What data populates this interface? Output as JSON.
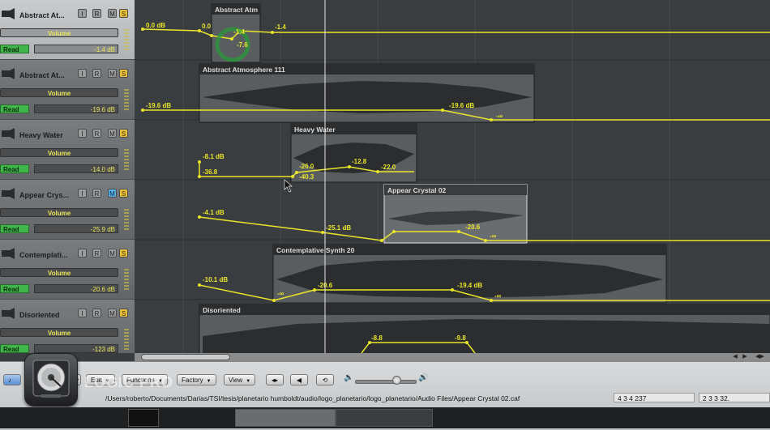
{
  "tracks": [
    {
      "name": "Abstract At...",
      "param": "Volume",
      "mode": "Read",
      "value": "-1.4 dB",
      "selected": true,
      "mute_on": false
    },
    {
      "name": "Abstract At...",
      "param": "Volume",
      "mode": "Read",
      "value": "-19.6 dB",
      "selected": false,
      "mute_on": false
    },
    {
      "name": "Heavy Water",
      "param": "Volume",
      "mode": "Read",
      "value": "-14.0 dB",
      "selected": false,
      "mute_on": false
    },
    {
      "name": "Appear Crys...",
      "param": "Volume",
      "mode": "Read",
      "value": "-25.9 dB",
      "selected": false,
      "mute_on": true
    },
    {
      "name": "Contemplati...",
      "param": "Volume",
      "mode": "Read",
      "value": "-20.6 dB",
      "selected": false,
      "mute_on": false
    },
    {
      "name": "Disoriented",
      "param": "Volume",
      "mode": "Read",
      "value": "-123 dB",
      "selected": false,
      "mute_on": false
    }
  ],
  "track_buttons": {
    "input": "I",
    "record": "R",
    "mute": "M",
    "solo": "S"
  },
  "regions": [
    {
      "name": "Abstract Atm"
    },
    {
      "name": "Abstract Atmosphere 111"
    },
    {
      "name": "Heavy Water"
    },
    {
      "name": "Appear Crystal 02"
    },
    {
      "name": "Contemplative Synth 20"
    },
    {
      "name": "Disoriented"
    }
  ],
  "automation_labels": [
    "0.0 dB",
    "0.0",
    "-1.4",
    "-7.6",
    "-1.4",
    "-19.6 dB",
    "-19.6 dB",
    "-∞",
    "-8.1 dB",
    "-36.8",
    "-26.0",
    "-40.3",
    "-12.8",
    "-22.0",
    "-4.1 dB",
    "-25.1 dB",
    "-20.6",
    "-∞",
    "-10.1 dB",
    "-∞",
    "-20.6",
    "-19.4 dB",
    "-∞",
    "-8.8",
    "-9.8"
  ],
  "toolbar": {
    "edit_label": "Edit",
    "functions_label": "Functions",
    "factory_label": "Factory",
    "view_label": "View"
  },
  "file_path": "/Users/roberto/Documents/Darias/TSI/tesis/planetario humboldt/audio/logo_planetario/logo_planetario/Audio Files/Appear Crystal 02.caf",
  "position_left": "4   3   4 237",
  "position_right": "2   3   3   32.",
  "logo_text": "LOGIC PRO",
  "colors": {
    "automation": "#e9e52a",
    "read": "#3fb54a",
    "solo": "#e8c23a",
    "mute_on": "#5ab0e6"
  }
}
